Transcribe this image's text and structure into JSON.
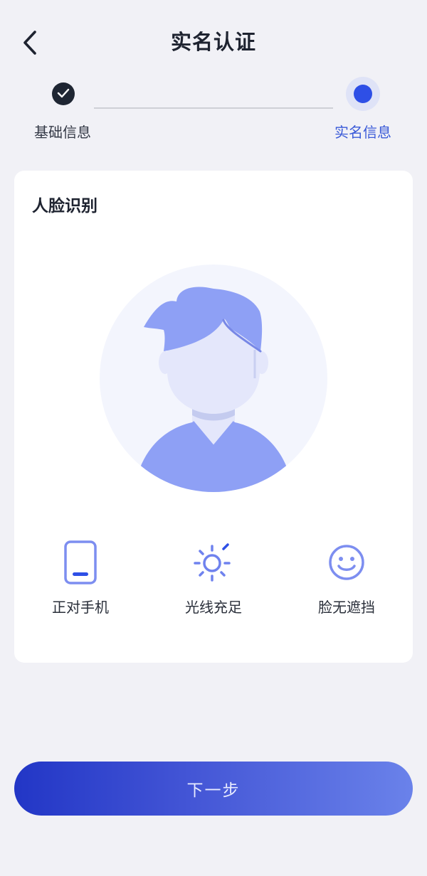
{
  "header": {
    "title": "实名认证",
    "back_icon": "chevron-left-icon"
  },
  "stepper": {
    "steps": [
      {
        "label": "基础信息",
        "status": "done",
        "icon": "check-icon"
      },
      {
        "label": "实名信息",
        "status": "current"
      }
    ]
  },
  "card": {
    "title": "人脸识别",
    "illustration": "face-avatar-illustration",
    "tips": [
      {
        "label": "正对手机",
        "icon": "phone-icon"
      },
      {
        "label": "光线充足",
        "icon": "sun-icon"
      },
      {
        "label": "脸无遮挡",
        "icon": "smile-icon"
      }
    ]
  },
  "footer": {
    "next_label": "下一步"
  },
  "colors": {
    "background": "#f1f1f6",
    "accent": "#2e4fe6",
    "accent_label": "#3a5ad8",
    "illustration_primary": "#8fa0f4",
    "button_gradient_start": "#2236c6",
    "button_gradient_end": "#6a82ea"
  }
}
